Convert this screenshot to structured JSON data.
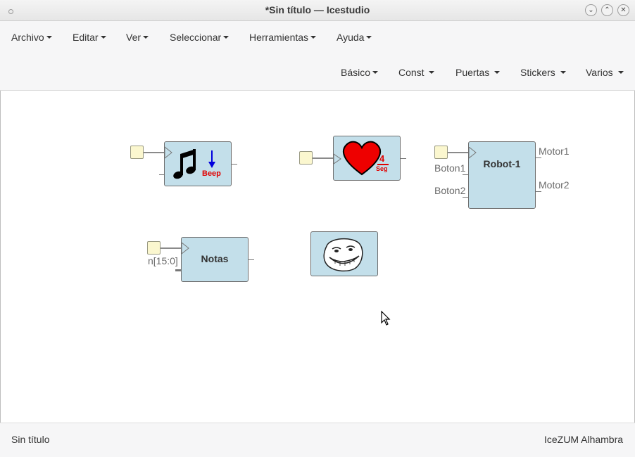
{
  "window": {
    "title": "*Sin título — Icestudio"
  },
  "menubar": {
    "row1": [
      "Archivo",
      "Editar",
      "Ver",
      "Seleccionar",
      "Herramientas",
      "Ayuda"
    ],
    "row2": [
      "Básico",
      "Const",
      "Puertas",
      "Stickers",
      "Varios"
    ]
  },
  "blocks": {
    "beep": {
      "label": "Beep"
    },
    "heart": {
      "number": "4",
      "unit": "Seg"
    },
    "robot": {
      "title": "Robot-1",
      "in1": "Boton1",
      "in2": "Boton2",
      "out1": "Motor1",
      "out2": "Motor2"
    },
    "notas": {
      "title": "Notas",
      "in": "n[15:0]"
    }
  },
  "footer": {
    "project": "Sin título",
    "board": "IceZUM Alhambra"
  }
}
